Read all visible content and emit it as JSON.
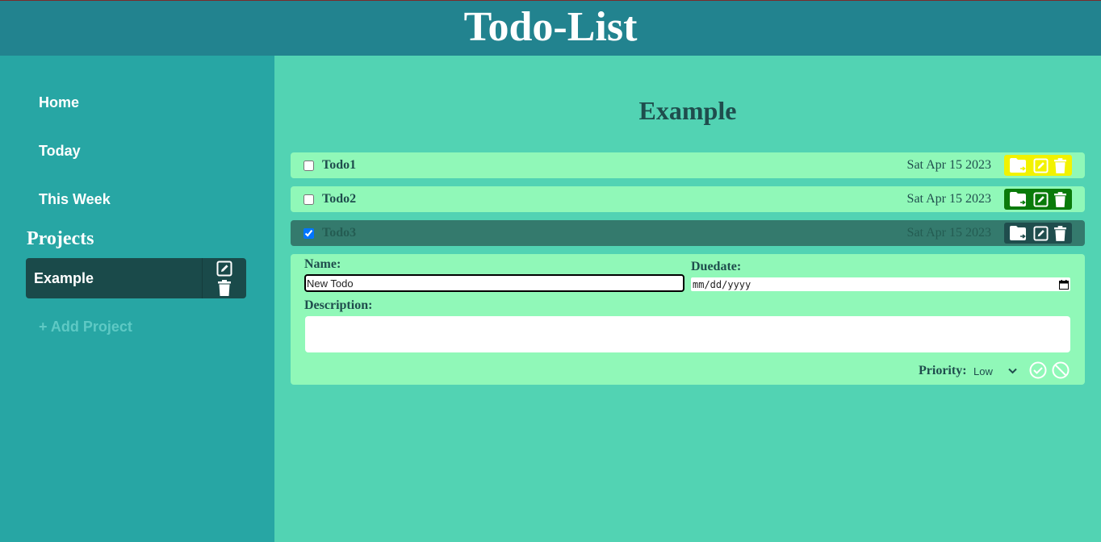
{
  "app": {
    "title": "Todo-List"
  },
  "sidebar": {
    "nav": [
      {
        "label": "Home"
      },
      {
        "label": "Today"
      },
      {
        "label": "This Week"
      }
    ],
    "projects_heading": "Projects",
    "projects": [
      {
        "name": "Example"
      }
    ],
    "add_project_label": "+ Add Project"
  },
  "main": {
    "title": "Example",
    "todos": [
      {
        "name": "Todo1",
        "date": "Sat Apr 15 2023",
        "checked": false,
        "priority_color": "#f2f200"
      },
      {
        "name": "Todo2",
        "date": "Sat Apr 15 2023",
        "checked": false,
        "priority_color": "#0a7a0a"
      },
      {
        "name": "Todo3",
        "date": "Sat Apr 15 2023",
        "checked": true,
        "priority_color": "#1f4d4d"
      }
    ],
    "form": {
      "name_label": "Name:",
      "name_value": "New Todo",
      "duedate_label": "Duedate:",
      "duedate_placeholder": "mm/dd/yyyy",
      "description_label": "Description:",
      "priority_label": "Priority:",
      "priority_value": "Low"
    }
  },
  "colors": {
    "header": "#22838f",
    "sidebar": "#27a6a4",
    "main": "#52d3b3",
    "todo_bg": "#90f8b8",
    "todo_done_bg": "#347a6d",
    "project_active": "#1a4a4a"
  }
}
